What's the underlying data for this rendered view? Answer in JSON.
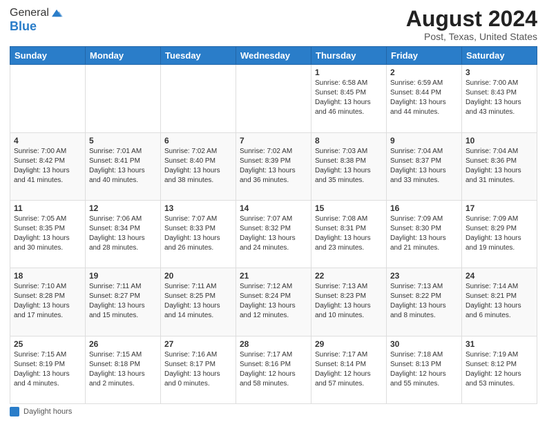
{
  "header": {
    "logo_general": "General",
    "logo_blue": "Blue",
    "main_title": "August 2024",
    "subtitle": "Post, Texas, United States"
  },
  "footer": {
    "legend_label": "Daylight hours"
  },
  "calendar": {
    "days_of_week": [
      "Sunday",
      "Monday",
      "Tuesday",
      "Wednesday",
      "Thursday",
      "Friday",
      "Saturday"
    ],
    "weeks": [
      [
        {
          "day": "",
          "info": ""
        },
        {
          "day": "",
          "info": ""
        },
        {
          "day": "",
          "info": ""
        },
        {
          "day": "",
          "info": ""
        },
        {
          "day": "1",
          "info": "Sunrise: 6:58 AM\nSunset: 8:45 PM\nDaylight: 13 hours\nand 46 minutes."
        },
        {
          "day": "2",
          "info": "Sunrise: 6:59 AM\nSunset: 8:44 PM\nDaylight: 13 hours\nand 44 minutes."
        },
        {
          "day": "3",
          "info": "Sunrise: 7:00 AM\nSunset: 8:43 PM\nDaylight: 13 hours\nand 43 minutes."
        }
      ],
      [
        {
          "day": "4",
          "info": "Sunrise: 7:00 AM\nSunset: 8:42 PM\nDaylight: 13 hours\nand 41 minutes."
        },
        {
          "day": "5",
          "info": "Sunrise: 7:01 AM\nSunset: 8:41 PM\nDaylight: 13 hours\nand 40 minutes."
        },
        {
          "day": "6",
          "info": "Sunrise: 7:02 AM\nSunset: 8:40 PM\nDaylight: 13 hours\nand 38 minutes."
        },
        {
          "day": "7",
          "info": "Sunrise: 7:02 AM\nSunset: 8:39 PM\nDaylight: 13 hours\nand 36 minutes."
        },
        {
          "day": "8",
          "info": "Sunrise: 7:03 AM\nSunset: 8:38 PM\nDaylight: 13 hours\nand 35 minutes."
        },
        {
          "day": "9",
          "info": "Sunrise: 7:04 AM\nSunset: 8:37 PM\nDaylight: 13 hours\nand 33 minutes."
        },
        {
          "day": "10",
          "info": "Sunrise: 7:04 AM\nSunset: 8:36 PM\nDaylight: 13 hours\nand 31 minutes."
        }
      ],
      [
        {
          "day": "11",
          "info": "Sunrise: 7:05 AM\nSunset: 8:35 PM\nDaylight: 13 hours\nand 30 minutes."
        },
        {
          "day": "12",
          "info": "Sunrise: 7:06 AM\nSunset: 8:34 PM\nDaylight: 13 hours\nand 28 minutes."
        },
        {
          "day": "13",
          "info": "Sunrise: 7:07 AM\nSunset: 8:33 PM\nDaylight: 13 hours\nand 26 minutes."
        },
        {
          "day": "14",
          "info": "Sunrise: 7:07 AM\nSunset: 8:32 PM\nDaylight: 13 hours\nand 24 minutes."
        },
        {
          "day": "15",
          "info": "Sunrise: 7:08 AM\nSunset: 8:31 PM\nDaylight: 13 hours\nand 23 minutes."
        },
        {
          "day": "16",
          "info": "Sunrise: 7:09 AM\nSunset: 8:30 PM\nDaylight: 13 hours\nand 21 minutes."
        },
        {
          "day": "17",
          "info": "Sunrise: 7:09 AM\nSunset: 8:29 PM\nDaylight: 13 hours\nand 19 minutes."
        }
      ],
      [
        {
          "day": "18",
          "info": "Sunrise: 7:10 AM\nSunset: 8:28 PM\nDaylight: 13 hours\nand 17 minutes."
        },
        {
          "day": "19",
          "info": "Sunrise: 7:11 AM\nSunset: 8:27 PM\nDaylight: 13 hours\nand 15 minutes."
        },
        {
          "day": "20",
          "info": "Sunrise: 7:11 AM\nSunset: 8:25 PM\nDaylight: 13 hours\nand 14 minutes."
        },
        {
          "day": "21",
          "info": "Sunrise: 7:12 AM\nSunset: 8:24 PM\nDaylight: 13 hours\nand 12 minutes."
        },
        {
          "day": "22",
          "info": "Sunrise: 7:13 AM\nSunset: 8:23 PM\nDaylight: 13 hours\nand 10 minutes."
        },
        {
          "day": "23",
          "info": "Sunrise: 7:13 AM\nSunset: 8:22 PM\nDaylight: 13 hours\nand 8 minutes."
        },
        {
          "day": "24",
          "info": "Sunrise: 7:14 AM\nSunset: 8:21 PM\nDaylight: 13 hours\nand 6 minutes."
        }
      ],
      [
        {
          "day": "25",
          "info": "Sunrise: 7:15 AM\nSunset: 8:19 PM\nDaylight: 13 hours\nand 4 minutes."
        },
        {
          "day": "26",
          "info": "Sunrise: 7:15 AM\nSunset: 8:18 PM\nDaylight: 13 hours\nand 2 minutes."
        },
        {
          "day": "27",
          "info": "Sunrise: 7:16 AM\nSunset: 8:17 PM\nDaylight: 13 hours\nand 0 minutes."
        },
        {
          "day": "28",
          "info": "Sunrise: 7:17 AM\nSunset: 8:16 PM\nDaylight: 12 hours\nand 58 minutes."
        },
        {
          "day": "29",
          "info": "Sunrise: 7:17 AM\nSunset: 8:14 PM\nDaylight: 12 hours\nand 57 minutes."
        },
        {
          "day": "30",
          "info": "Sunrise: 7:18 AM\nSunset: 8:13 PM\nDaylight: 12 hours\nand 55 minutes."
        },
        {
          "day": "31",
          "info": "Sunrise: 7:19 AM\nSunset: 8:12 PM\nDaylight: 12 hours\nand 53 minutes."
        }
      ]
    ]
  }
}
